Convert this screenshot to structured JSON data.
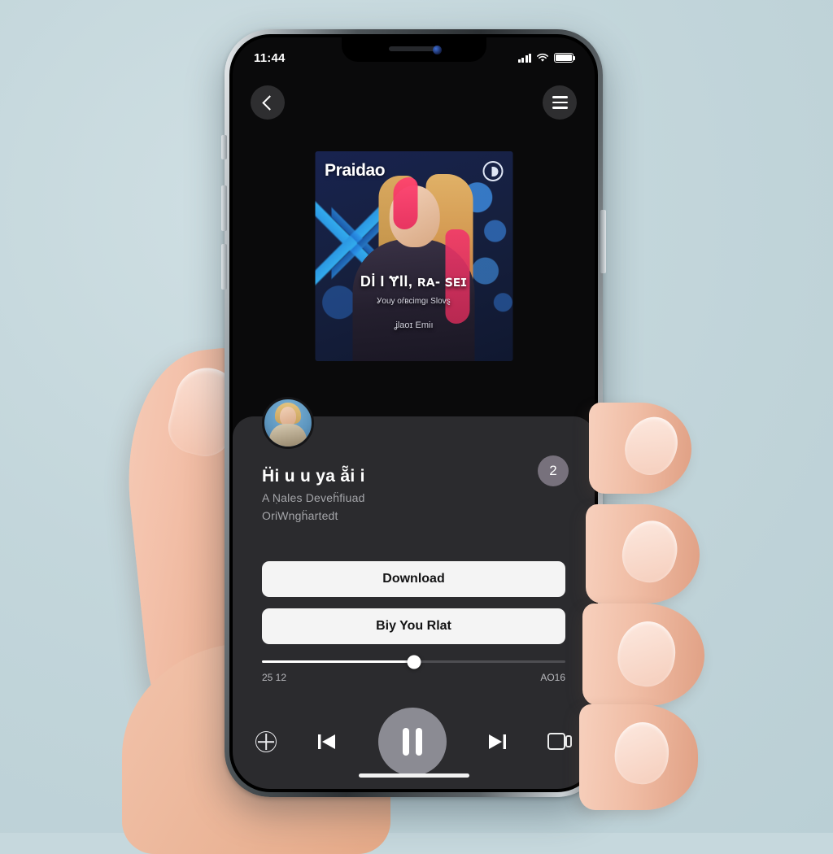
{
  "status_bar": {
    "time": "11:44",
    "signal_icon": "cellular-signal-icon",
    "wifi_icon": "wifi-icon",
    "battery_icon": "battery-full-icon"
  },
  "top_nav": {
    "back_icon": "chevron-left-icon",
    "menu_icon": "hamburger-menu-icon"
  },
  "thumbnail": {
    "logo": "Praidao",
    "badge_icon": "progress-circle-icon",
    "overlay_title": "Dİ I Ɏll, ʀᴀ- ꜱᴇɪ",
    "overlay_subtitle": "Ỿouy oŕʙcimgı Slovȿ",
    "overlay_footer": "ʝlaoɪ Emiı"
  },
  "card": {
    "avatar_icon": "channel-avatar",
    "title": "Ḧi u u ya ẵi i",
    "subtitle_line1": "A Ṇales Deveḧfiuad",
    "subtitle_line2": "OriWngḧarted‎t",
    "count_badge": "2"
  },
  "actions": {
    "primary_label": "Download",
    "secondary_label": "Biy You Rlat"
  },
  "player": {
    "elapsed_time": "25 12",
    "total_time": "AO16",
    "progress_percent": 50,
    "repeat_icon": "repeat-icon",
    "previous_icon": "skip-previous-icon",
    "play_pause_icon": "pause-icon",
    "next_icon": "skip-next-icon",
    "cast_icon": "cast-screen-icon"
  },
  "colors": {
    "background": "#c6d8dd",
    "screen": "#0a0a0b",
    "card": "#2b2b2e",
    "button": "#f4f4f4",
    "accent_badge": "#77717c",
    "play_button": "#8b8b93"
  }
}
